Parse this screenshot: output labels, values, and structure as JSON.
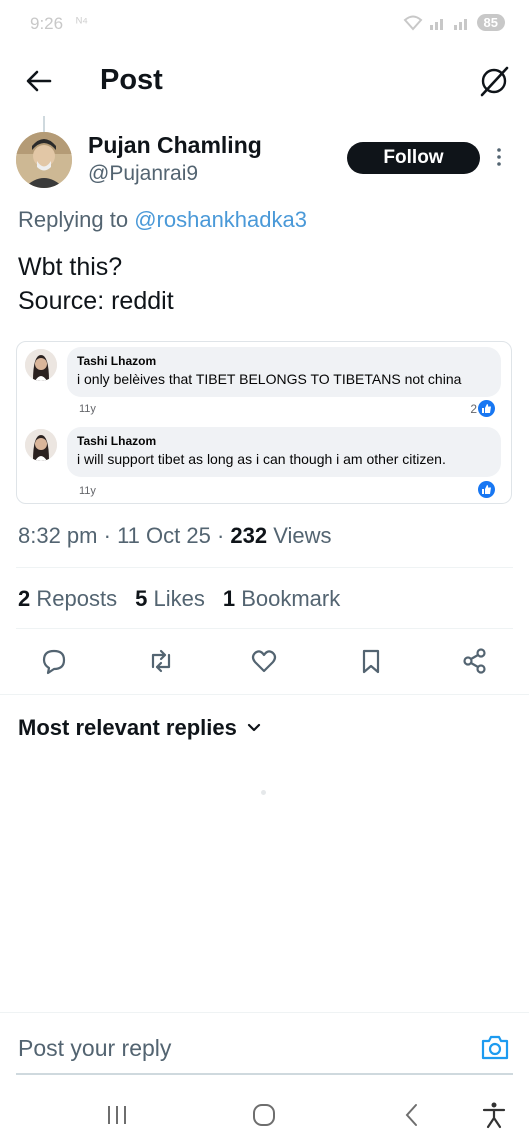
{
  "status_bar": {
    "time": "9:26",
    "extra": "ᴺ⁴",
    "battery": "85"
  },
  "header": {
    "title": "Post"
  },
  "post": {
    "author_name": "Pujan Chamling",
    "author_handle": "@Pujanrai9",
    "follow_label": "Follow",
    "replying_prefix": "Replying to",
    "replying_mention": "@roshankhadka3",
    "text": "Wbt this?\nSource: reddit",
    "embedded_comments": [
      {
        "name": "Tashi Lhazom",
        "text": "i only belèives that TIBET BELONGS TO TIBETANS not china",
        "time": "11y",
        "likes": "2"
      },
      {
        "name": "Tashi Lhazom",
        "text": "i will support tibet as long as i can though i am other citizen.",
        "time": "11y",
        "likes": ""
      }
    ],
    "time": "8:32 pm",
    "date": "11 Oct 25",
    "views_count": "232",
    "views_label": "Views"
  },
  "stats": {
    "reposts_count": "2",
    "reposts_label": "Reposts",
    "likes_count": "5",
    "likes_label": "Likes",
    "bookmarks_count": "1",
    "bookmarks_label": "Bookmark"
  },
  "actions": [
    "reply-icon",
    "repost-icon",
    "like-icon",
    "bookmark-icon",
    "share-icon"
  ],
  "replies": {
    "sort_label": "Most relevant replies"
  },
  "reply_bar": {
    "placeholder": "Post your reply"
  },
  "colors": {
    "accent": "#1d9bf0",
    "mention": "#4a99d8",
    "secondary_text": "#536471",
    "fb_like": "#1877f2"
  }
}
